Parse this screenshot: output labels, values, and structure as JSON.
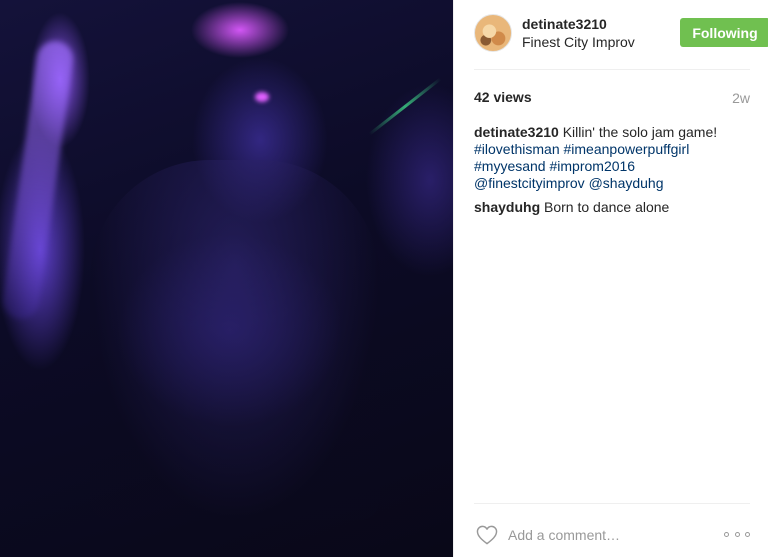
{
  "post": {
    "username": "detinate3210",
    "location": "Finest City Improv",
    "follow_label": "Following",
    "views": "42 views",
    "time_ago": "2w"
  },
  "caption": {
    "user": "detinate3210",
    "text": " Killin' the solo jam game! ",
    "tags": [
      "#ilovethisman",
      "#imeanpowerpuffgirl",
      "#myyesand",
      "#improm2016",
      "@finestcityimprov",
      "@shayduhg"
    ]
  },
  "comments": [
    {
      "user": "shayduhg",
      "text": " Born to dance alone"
    }
  ],
  "footer": {
    "comment_placeholder": "Add a comment…",
    "like_icon": "heart-outline-icon",
    "more_icon": "ellipsis-icon"
  },
  "colors": {
    "follow_button": "#70c050",
    "hashtag": "#003569",
    "muted": "#999999"
  }
}
